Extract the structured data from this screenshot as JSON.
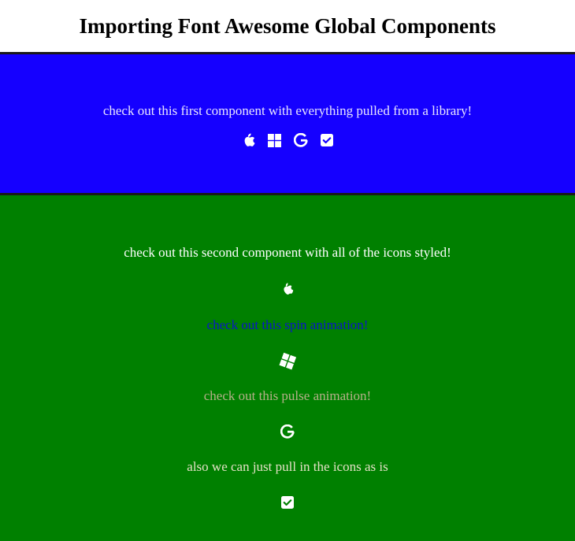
{
  "header": {
    "title": "Importing Font Awesome Global Components"
  },
  "first_component": {
    "text": "check out this first component with everything pulled from a library!",
    "icons": [
      "apple-icon",
      "windows-icon",
      "google-icon",
      "square-check-icon"
    ],
    "background": "#1500ff"
  },
  "second_component": {
    "text": "check out this second component with all of the icons styled!",
    "spin_text": "check out this spin animation!",
    "pulse_text": "check out this pulse animation!",
    "plain_text": "also we can just pull in the icons as is",
    "icons": [
      "apple-icon",
      "windows-icon",
      "google-icon",
      "square-check-icon"
    ],
    "background": "#008000"
  }
}
